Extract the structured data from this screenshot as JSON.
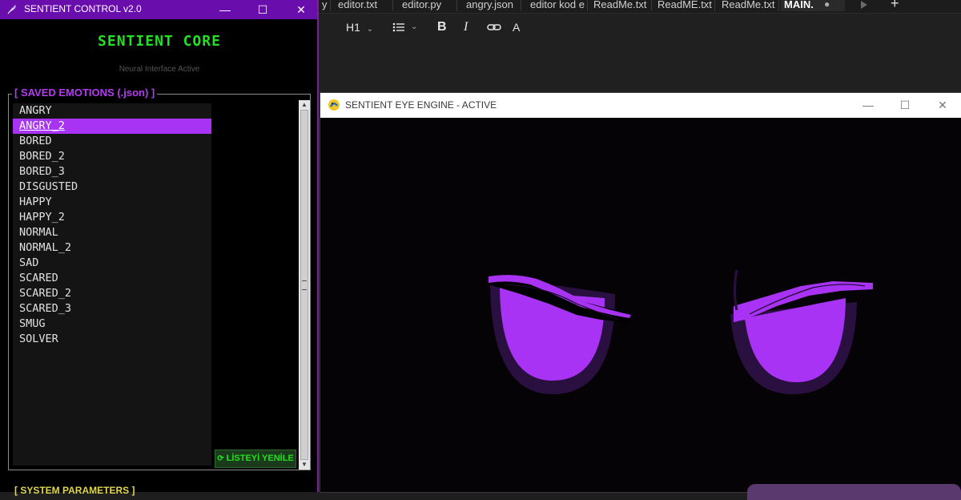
{
  "editor": {
    "tabs": [
      {
        "label": "y",
        "active": false
      },
      {
        "label": "editor.txt",
        "active": false
      },
      {
        "label": "editor.py",
        "active": false
      },
      {
        "label": "angry.json",
        "active": false
      },
      {
        "label": "editor kod e",
        "active": false
      },
      {
        "label": "ReadMe.txt",
        "active": false
      },
      {
        "label": "ReadME.txt",
        "active": false
      },
      {
        "label": "ReadMe.txt",
        "active": false
      },
      {
        "label": "MAIN.",
        "active": true
      }
    ],
    "toolbar": {
      "heading_label": "H1",
      "bold_label": "B",
      "italic_label": "I",
      "format_label": "A"
    }
  },
  "eye_window": {
    "title": "SENTIENT EYE ENGINE - ACTIVE",
    "eye_color": "#a933f5",
    "eye_shadow_color": "#2a1040"
  },
  "control_window": {
    "title": "SENTIENT CONTROL v2.0",
    "core_title": "SENTIENT CORE",
    "core_subtitle": "Neural Interface Active",
    "group_label": "[ SAVED EMOTIONS (.json) ]",
    "emotions": [
      "ANGRY",
      "ANGRY_2",
      "BORED",
      "BORED_2",
      "BORED_3",
      "DISGUSTED",
      "HAPPY",
      "HAPPY_2",
      "NORMAL",
      "NORMAL_2",
      "SAD",
      "SCARED",
      "SCARED_2",
      "SCARED_3",
      "SMUG",
      "SOLVER"
    ],
    "selected_emotion": "ANGRY_2",
    "refresh_label": "LİSTEYİ YENİLE",
    "refresh_icon": "refresh-icon",
    "next_section_label": "[ SYSTEM PARAMETERS ]"
  },
  "colors": {
    "accent_purple": "#a933f5",
    "title_purple": "#6a0dad",
    "terminal_green": "#22e022"
  }
}
